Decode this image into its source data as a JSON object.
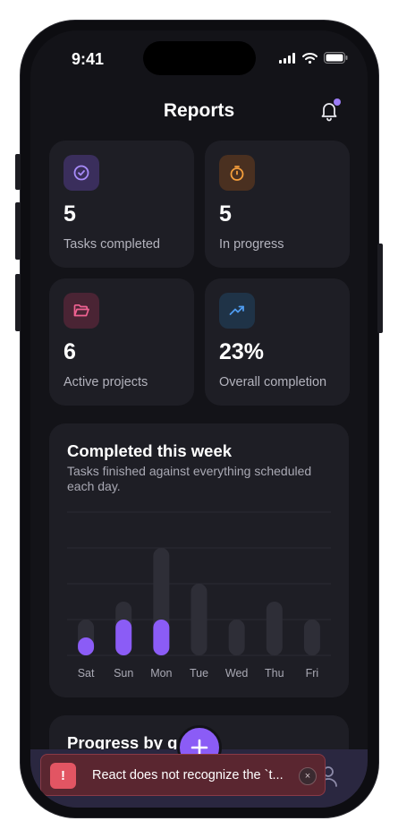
{
  "status_bar": {
    "time": "9:41"
  },
  "header": {
    "title": "Reports"
  },
  "stats": [
    {
      "value": "5",
      "label": "Tasks completed",
      "icon": "check-circle-icon",
      "color": "#a78bfa",
      "bg": "#3a2e5c"
    },
    {
      "value": "5",
      "label": "In progress",
      "icon": "stopwatch-icon",
      "color": "#f59e3b",
      "bg": "#4a3020"
    },
    {
      "value": "6",
      "label": "Active projects",
      "icon": "folder-open-icon",
      "color": "#f06292",
      "bg": "#4a2434"
    },
    {
      "value": "23%",
      "label": "Overall completion",
      "icon": "trending-up-icon",
      "color": "#4f9cf0",
      "bg": "#1f3347"
    }
  ],
  "weekly": {
    "title": "Completed this week",
    "subtitle": "Tasks finished against everything scheduled each day."
  },
  "progress": {
    "title": "Progress by g"
  },
  "toast": {
    "message": "React does not recognize the `t...",
    "badge": "!",
    "close": "×"
  },
  "colors": {
    "accent": "#8b5cf6",
    "track": "#2e2e37",
    "background": "#131318",
    "card": "#1e1e25"
  },
  "chart_data": {
    "type": "bar",
    "categories": [
      "Sat",
      "Sun",
      "Mon",
      "Tue",
      "Wed",
      "Thu",
      "Fri"
    ],
    "series": [
      {
        "values": [
          1,
          2,
          2,
          0,
          0,
          0,
          0
        ]
      },
      {
        "values": [
          2,
          3,
          6,
          4,
          2,
          3,
          2
        ]
      }
    ],
    "ylim": [
      0,
      8
    ],
    "grid": true,
    "title": "Completed this week",
    "xlabel": "",
    "ylabel": ""
  }
}
